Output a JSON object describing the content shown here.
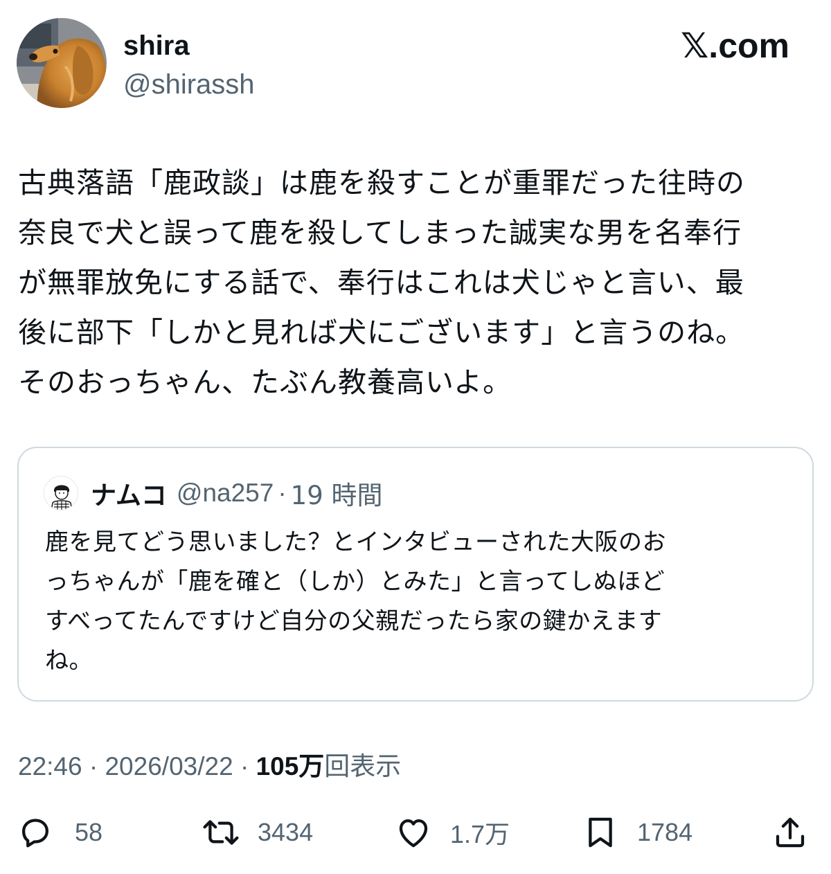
{
  "author": {
    "display_name": "shira",
    "handle": "@shirassh",
    "avatar_icon": "dog-avatar-icon"
  },
  "site_logo": {
    "x": "𝕏",
    "suffix": ".com"
  },
  "tweet": {
    "lines": [
      "古典落語「鹿政談」は鹿を殺すことが重罪だった往時の",
      "奈良で犬と誤って鹿を殺してしまった誠実な男を名奉行",
      "が無罪放免にする話で、奉行はこれは犬じゃと言い、最",
      "後に部下「しかと見れば犬にございます」と言うのね。",
      "そのおっちゃん、たぶん教養高いよ。"
    ]
  },
  "quote": {
    "display_name": "ナムコ",
    "handle": "@na257",
    "separator": "·",
    "time": "19 時間",
    "lines": [
      "鹿を見てどう思いました？とインタビューされた大阪のお",
      "っちゃんが「鹿を確と（しか）とみた」と言ってしぬほど",
      "すべってたんですけど自分の父親だったら家の鍵かえます",
      "ね。"
    ]
  },
  "meta": {
    "time": "22:46",
    "sep1": "·",
    "date": "2026/03/22",
    "sep2": "·",
    "views_count": "105万",
    "views_label": "回表示"
  },
  "actions": {
    "reply": {
      "count": "58",
      "icon": "reply-icon"
    },
    "retweet": {
      "count": "3434",
      "icon": "retweet-icon"
    },
    "like": {
      "count": "1.7万",
      "icon": "heart-icon"
    },
    "bookmark": {
      "count": "1784",
      "icon": "bookmark-icon"
    },
    "share": {
      "icon": "share-icon"
    }
  },
  "colors": {
    "text": "#0f1419",
    "secondary": "#536471",
    "border": "#cfd9de"
  }
}
